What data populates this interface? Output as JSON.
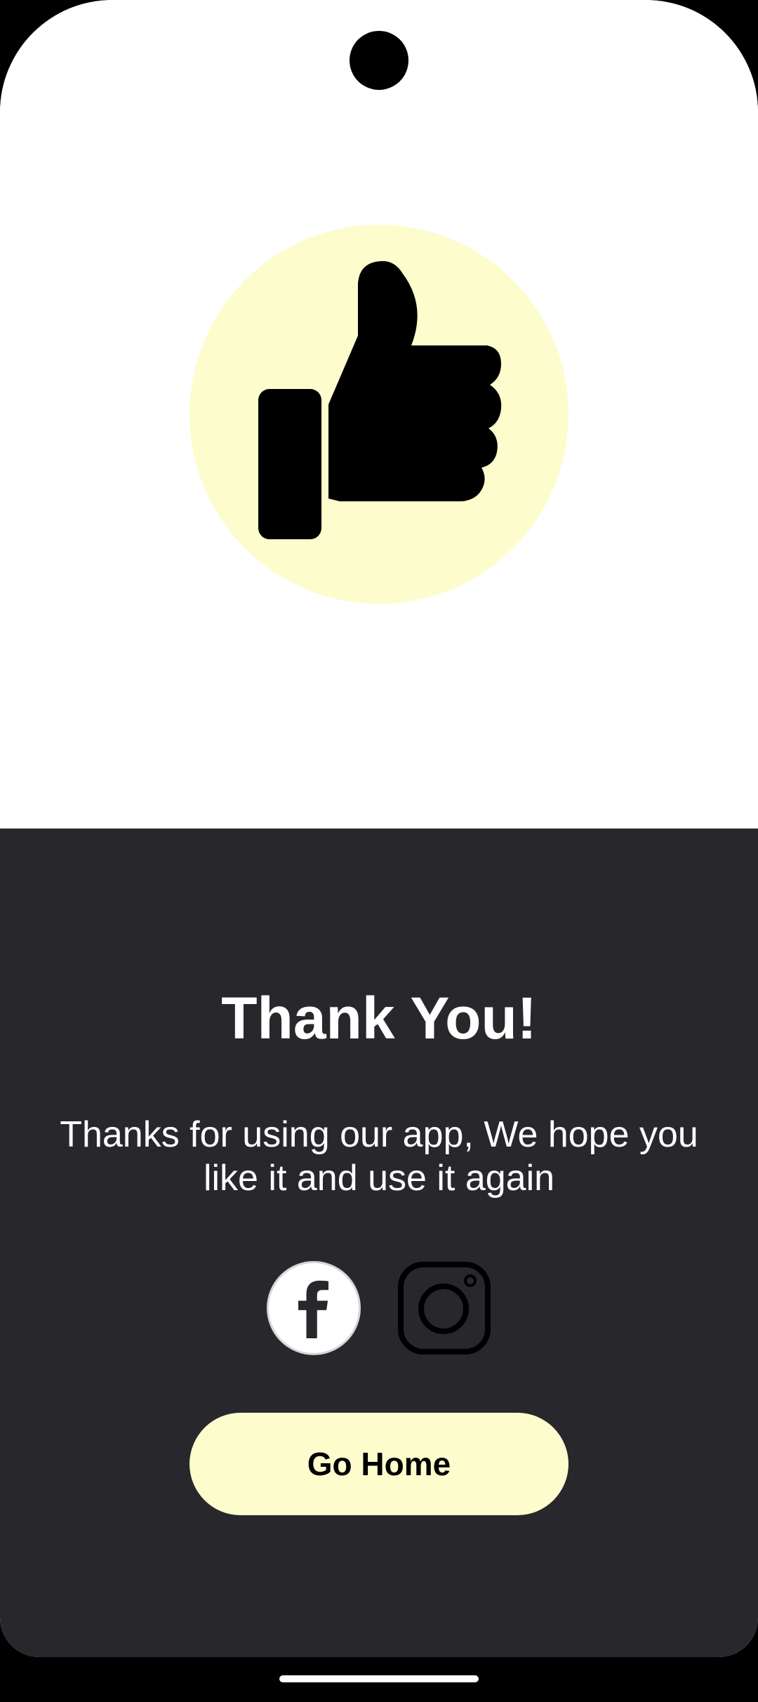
{
  "hero": {
    "icon": "thumbs-up-icon",
    "circle_color": "#fdfccc"
  },
  "content": {
    "title": "Thank You!",
    "message": "Thanks for using our app, We hope you like it and use it again"
  },
  "socials": [
    {
      "icon": "facebook-icon"
    },
    {
      "icon": "instagram-icon"
    }
  ],
  "actions": {
    "go_home_label": "Go Home"
  },
  "colors": {
    "accent": "#fdfccc",
    "panel_background": "#28272b",
    "hero_background": "#ffffff"
  }
}
